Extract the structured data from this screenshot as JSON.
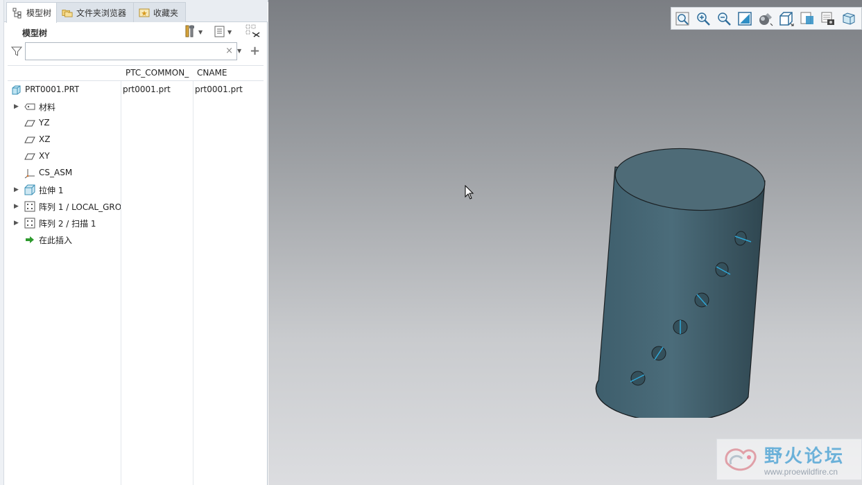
{
  "tabs": [
    {
      "label": "模型树",
      "icon": "model-tree-icon",
      "active": true
    },
    {
      "label": "文件夹浏览器",
      "icon": "folder-browser-icon",
      "active": false
    },
    {
      "label": "收藏夹",
      "icon": "favorites-icon",
      "active": false
    }
  ],
  "panel": {
    "title": "模型树"
  },
  "search": {
    "placeholder": "",
    "value": "",
    "clear_symbol": "×",
    "add_symbol": "+"
  },
  "table": {
    "columns": [
      "",
      "PTC_COMMON_",
      "CNAME"
    ],
    "rows": [
      {
        "label": "PRT0001.PRT",
        "icon": "part-icon",
        "expandable": false,
        "indent": 0,
        "ptc_common": "prt0001.prt",
        "cname": "prt0001.prt"
      },
      {
        "label": "材料",
        "icon": "material-icon",
        "expandable": true,
        "indent": 1,
        "ptc_common": "",
        "cname": ""
      },
      {
        "label": "YZ",
        "icon": "datum-plane-icon",
        "expandable": false,
        "indent": 1,
        "ptc_common": "",
        "cname": ""
      },
      {
        "label": "XZ",
        "icon": "datum-plane-icon",
        "expandable": false,
        "indent": 1,
        "ptc_common": "",
        "cname": ""
      },
      {
        "label": "XY",
        "icon": "datum-plane-icon",
        "expandable": false,
        "indent": 1,
        "ptc_common": "",
        "cname": ""
      },
      {
        "label": "CS_ASM",
        "icon": "coordinate-system-icon",
        "expandable": false,
        "indent": 1,
        "ptc_common": "",
        "cname": ""
      },
      {
        "label": "拉伸 1",
        "icon": "extrude-icon",
        "expandable": true,
        "indent": 1,
        "ptc_common": "",
        "cname": ""
      },
      {
        "label": "阵列 1 / LOCAL_GRO",
        "icon": "pattern-icon",
        "expandable": true,
        "indent": 1,
        "ptc_common": "",
        "cname": ""
      },
      {
        "label": "阵列 2 / 扫描 1",
        "icon": "pattern-icon",
        "expandable": true,
        "indent": 1,
        "ptc_common": "",
        "cname": ""
      },
      {
        "label": "在此插入",
        "icon": "insert-here-icon",
        "expandable": false,
        "indent": 1,
        "ptc_common": "",
        "cname": ""
      }
    ]
  },
  "view_toolbar": [
    "refit-icon",
    "zoom-in-icon",
    "zoom-out-icon",
    "repaint-icon",
    "render-style-icon",
    "saved-orientations-icon",
    "view-manager-icon",
    "display-filters-icon",
    "annotation-display-icon"
  ],
  "watermark": {
    "title": "野火论坛",
    "url": "www.proewildfire.cn"
  },
  "colors": {
    "model": "#3f5b67",
    "viewport_top": "#7b7e83",
    "viewport_bottom": "#dcdde0",
    "hole_axis": "#2fa8d8"
  }
}
